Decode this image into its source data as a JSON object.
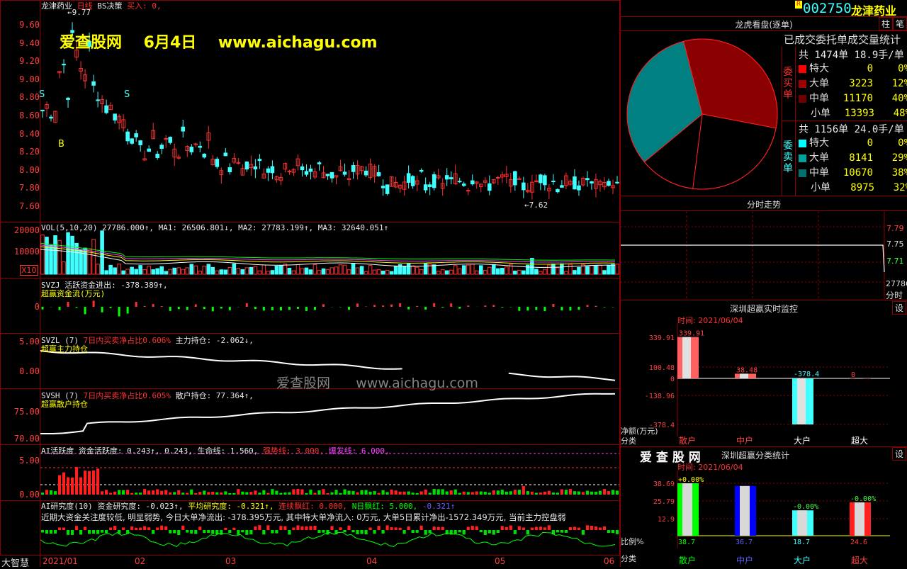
{
  "main": {
    "stock_title": "龙津药业",
    "period": "日线",
    "strategy": "BS决策",
    "buy_label": "买入: 0,",
    "high_label": "9.77",
    "low_label": "7.62",
    "price_ticks": [
      "9.60",
      "9.40",
      "9.20",
      "9.00",
      "8.80",
      "8.60",
      "8.40",
      "8.20",
      "8.00",
      "7.80",
      "7.60"
    ],
    "watermark": "爱查股网    6月4日    www.aichagu.com",
    "marker_s": "S",
    "marker_b": "B"
  },
  "vol": {
    "label": "VOL(5,10,20) 27786.000↑, MA1: 26506.801↓, MA2: 27783.199↑, MA3: 32640.051↑",
    "ticks": [
      "20000",
      "10000"
    ],
    "unit": "X10"
  },
  "svzj": {
    "line1": "SVZJ  活跃资金进出: -378.389↑,",
    "line2": "超赢资金流(万元)",
    "tick": "0"
  },
  "svzl": {
    "line1a": "SVZL (7) ",
    "line1b": "7日内买卖净占比0.606%",
    "line1c": " 主力持仓: -2.062↓,",
    "line2": "超赢主力持仓",
    "ticks": [
      "5.00",
      "0.00"
    ]
  },
  "svsh": {
    "line1a": "SVSH (7) ",
    "line1b": "7日内买卖净占比0.605%",
    "line1c": " 散户持仓: 77.364↑,",
    "line2": "超赢散户持仓",
    "ticks": [
      "75.00",
      "70.00"
    ],
    "watermark": "爱查股网      www.aichagu.com"
  },
  "ai1": {
    "a": "AI活跃度  资金活跃度: 0.243↑, 0.243, 生命线: 1.560, ",
    "b": "强势线: 3.000, ",
    "c": "爆发线: 6.000,",
    "ticks": [
      "5.00",
      "0.00"
    ]
  },
  "ai2": {
    "a": "AI研究度(10) 资金研究度: -0.023↑, ",
    "b": "平均研究度: -0.321↑, ",
    "c": "连续飘红: 0.000, ",
    "d": "N日飘红: 5.000, ",
    "e": "-0.321↑",
    "text": "近期大资金关注度较低, 明显弱势, 今日大单净流出: -378.395万元, 其中特大单净流入: 0万元, 大单5日累计净出-1572.349万元, 当前主力控盘弱"
  },
  "bottom": {
    "brand": "大智慧",
    "dates": [
      "2021/01",
      "02",
      "03",
      "04",
      "05",
      "06"
    ]
  },
  "right": {
    "code": "002750",
    "name": "龙津药业",
    "code_badge": "R",
    "btn_zhu": "柱",
    "btn_bi": "笔",
    "pie_title": "龙虎看盘(逐单)",
    "stat_title": "已成交委托单成交量统计",
    "buy_side": "委买单",
    "sell_side": "委卖单",
    "buy_total": "共 1474单 18.9手/单",
    "sell_total": "共 1156单 24.0手/单",
    "buy_rows": [
      {
        "k": "特大",
        "v": "0",
        "p": "0%",
        "color": "#ff0000"
      },
      {
        "k": "大单",
        "v": "3223",
        "p": "12%",
        "color": "#a00000"
      },
      {
        "k": "中单",
        "v": "11170",
        "p": "40%",
        "color": "#700000"
      },
      {
        "k": "小单",
        "v": "13393",
        "p": "48%",
        "color": "#000000"
      }
    ],
    "sell_rows": [
      {
        "k": "特大",
        "v": "0",
        "p": "0%",
        "color": "#00ffff"
      },
      {
        "k": "大单",
        "v": "8141",
        "p": "29%",
        "color": "#00a0a0"
      },
      {
        "k": "中单",
        "v": "10670",
        "p": "38%",
        "color": "#007070"
      },
      {
        "k": "小单",
        "v": "8975",
        "p": "32%",
        "color": "#000000"
      }
    ],
    "ft_title": "分时走势",
    "ft_ticks": [
      "7.79",
      "7.75",
      "7.71"
    ],
    "ft_vol": "27786",
    "ft_unit": "分时",
    "mon_title": "深圳超赢实时监控",
    "mon_btn": "设",
    "mon_time": "时间: 2021/06/04",
    "mon_ticks": [
      "339.91",
      "100.48",
      "0",
      "-138.96",
      "-378.4"
    ],
    "mon_vals": [
      "339.91",
      "38.48",
      "-378.4",
      "0"
    ],
    "mon_ylabel": "净额(万元)",
    "mon_xlabel": "分类",
    "mon_cats": [
      "散户",
      "中户",
      "大户",
      "超大"
    ],
    "cls_brand": "爱 查 股 网",
    "cls_title": "深圳超赢分类统计",
    "cls_btn": "设",
    "cls_time": "时间: 2021/06/04",
    "cls_ticks": [
      "38.69",
      "25.79",
      "12.9"
    ],
    "cls_top": [
      "+0.00%",
      "",
      "-0.00%",
      "-0.00%"
    ],
    "cls_vals": [
      "38.7",
      "36.7",
      "18.7",
      "24.6"
    ],
    "cls_ylabel": "比例%",
    "cls_xlabel": "分类",
    "cls_cats": [
      "散户",
      "中户",
      "大户",
      "超大"
    ]
  }
}
